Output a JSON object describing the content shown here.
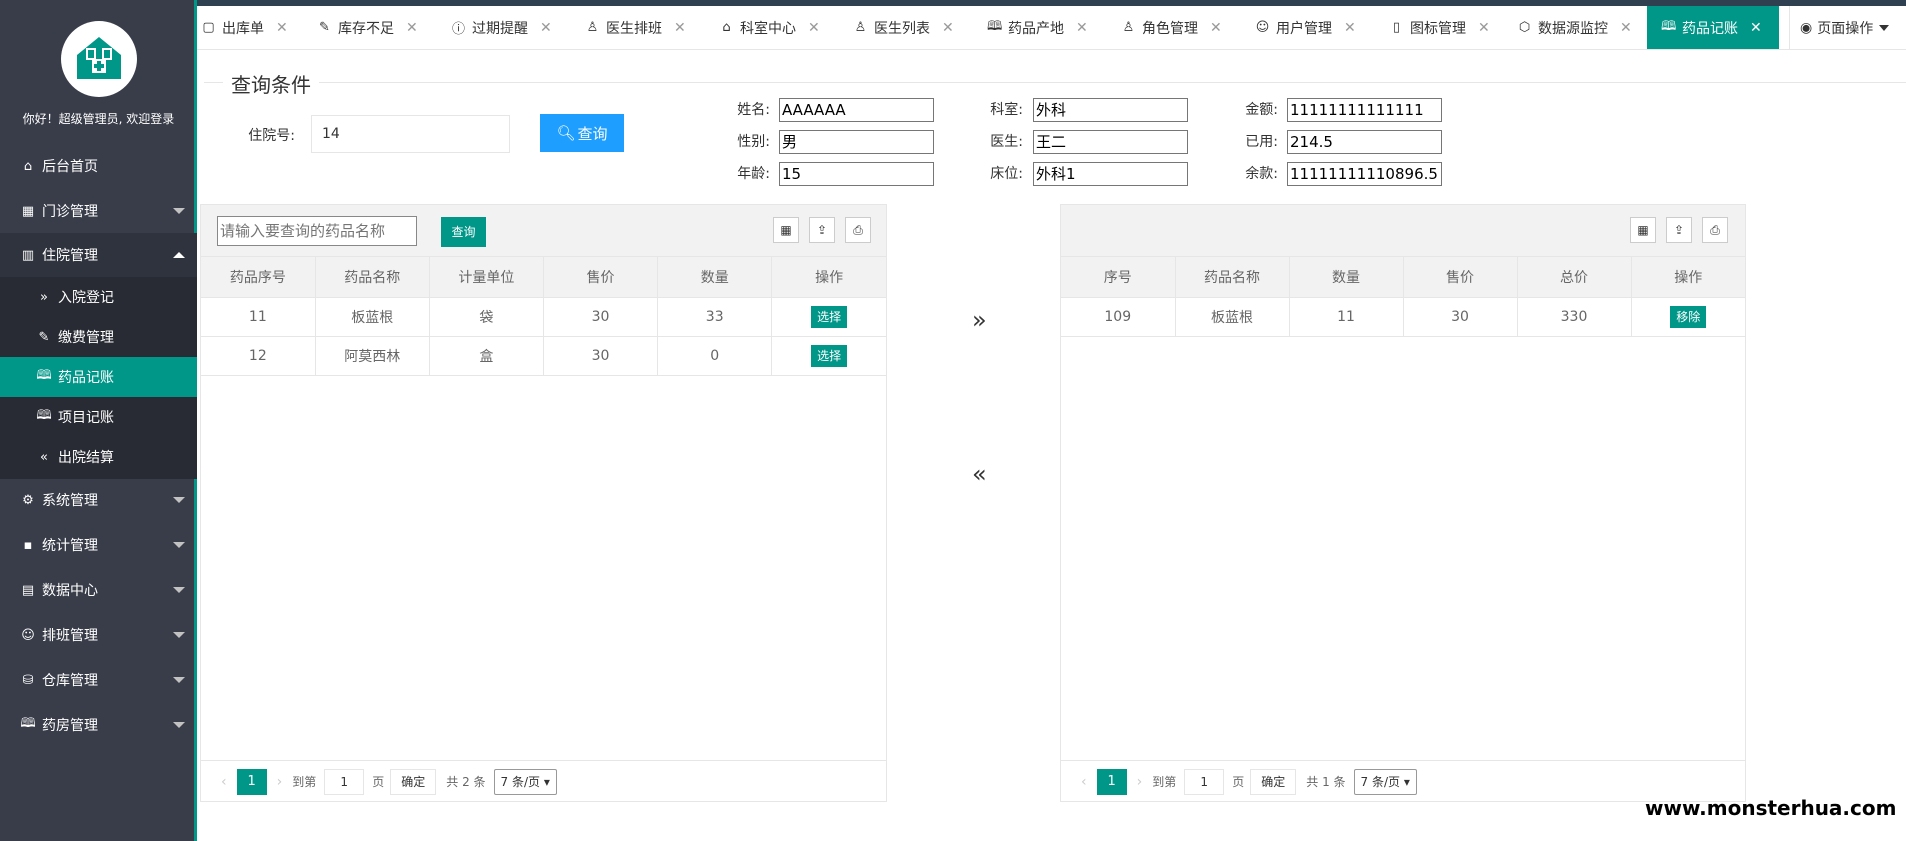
{
  "sidebar": {
    "welcome": "你好！超级管理员, 欢迎登录",
    "items": [
      {
        "label": "后台首页",
        "icon": "home-icon"
      },
      {
        "label": "门诊管理",
        "icon": "grid-icon"
      },
      {
        "label": "住院管理",
        "icon": "bed-icon"
      },
      {
        "label": "系统管理",
        "icon": "gear-icon"
      },
      {
        "label": "统计管理",
        "icon": "chart-icon"
      },
      {
        "label": "数据中心",
        "icon": "database-icon"
      },
      {
        "label": "排班管理",
        "icon": "users-icon"
      },
      {
        "label": "仓库管理",
        "icon": "warehouse-icon"
      },
      {
        "label": "药房管理",
        "icon": "book-icon"
      }
    ],
    "sub_items": [
      {
        "label": "入院登记",
        "icon": "double-chevron-right-icon"
      },
      {
        "label": "缴费管理",
        "icon": "edit-icon"
      },
      {
        "label": "药品记账",
        "icon": "book-icon"
      },
      {
        "label": "项目记账",
        "icon": "book-icon"
      },
      {
        "label": "出院结算",
        "icon": "double-chevron-left-icon"
      }
    ]
  },
  "tabs": [
    {
      "label": "出库单",
      "icon": "file-icon"
    },
    {
      "label": "库存不足",
      "icon": "edit-icon"
    },
    {
      "label": "过期提醒",
      "icon": "info-icon"
    },
    {
      "label": "医生排班",
      "icon": "user-icon"
    },
    {
      "label": "科室中心",
      "icon": "home-icon"
    },
    {
      "label": "医生列表",
      "icon": "user-icon"
    },
    {
      "label": "药品产地",
      "icon": "book-icon"
    },
    {
      "label": "角色管理",
      "icon": "user-icon"
    },
    {
      "label": "用户管理",
      "icon": "users-icon"
    },
    {
      "label": "图标管理",
      "icon": "note-icon"
    },
    {
      "label": "数据源监控",
      "icon": "cube-icon"
    },
    {
      "label": "药品记账",
      "icon": "book-icon"
    }
  ],
  "page_ops_label": "页面操作",
  "query": {
    "legend": "查询条件",
    "admit_label": "住院号:",
    "admit_value": "14",
    "query_button": "查询"
  },
  "patient": {
    "name_label": "姓名:",
    "name": "AAAAAA",
    "gender_label": "性别:",
    "gender": "男",
    "age_label": "年龄:",
    "age": "15",
    "dept_label": "科室:",
    "dept": "外科",
    "doctor_label": "医生:",
    "doctor": "王二",
    "bed_label": "床位:",
    "bed": "外科1",
    "amount_label": "金额:",
    "amount": "11111111111111",
    "used_label": "已用:",
    "used": "214.5",
    "balance_label": "余款:",
    "balance": "11111111110896.5"
  },
  "left_table": {
    "search_placeholder": "请输入要查询的药品名称",
    "search_button": "查询",
    "columns": [
      "药品序号",
      "药品名称",
      "计量单位",
      "售价",
      "数量",
      "操作"
    ],
    "rows": [
      {
        "id": "11",
        "name": "板蓝根",
        "unit": "袋",
        "price": "30",
        "qty": "33",
        "action": "选择"
      },
      {
        "id": "12",
        "name": "阿莫西林",
        "unit": "盒",
        "price": "30",
        "qty": "0",
        "action": "选择"
      }
    ],
    "pager": {
      "current": "1",
      "goto_label": "到第",
      "page_input": "1",
      "page_unit": "页",
      "confirm": "确定",
      "total": "共 2 条",
      "per_page": "7 条/页"
    }
  },
  "right_table": {
    "columns": [
      "序号",
      "药品名称",
      "数量",
      "售价",
      "总价",
      "操作"
    ],
    "rows": [
      {
        "id": "109",
        "name": "板蓝根",
        "qty": "11",
        "price": "30",
        "total": "330",
        "action": "移除"
      }
    ],
    "pager": {
      "current": "1",
      "goto_label": "到第",
      "page_input": "1",
      "page_unit": "页",
      "confirm": "确定",
      "total": "共 1 条",
      "per_page": "7 条/页"
    }
  },
  "watermark": "www.monsterhua.com",
  "colors": {
    "accent": "#009688",
    "sidebar": "#393d49",
    "primary_button": "#1e9fff"
  }
}
